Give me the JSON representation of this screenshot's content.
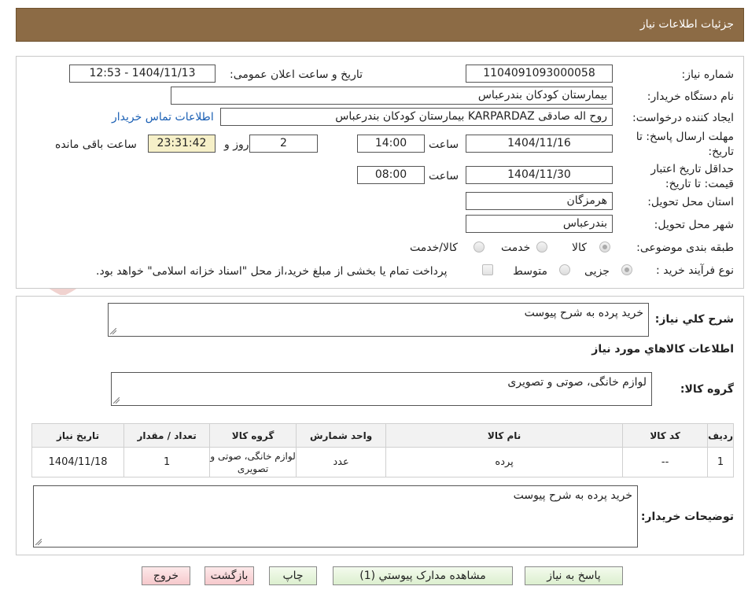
{
  "header": {
    "title": "جزئیات اطلاعات نیاز"
  },
  "info": {
    "need_number_label": "شماره نیاز:",
    "need_number": "1104091093000058",
    "announce_label": "تاریخ و ساعت اعلان عمومی:",
    "announce_value": "1404/11/13 - 12:53",
    "buyer_org_label": "نام دستگاه خریدار:",
    "buyer_org": "بیمارستان کودکان بندرعباس",
    "requester_label": "ایجاد کننده درخواست:",
    "requester": "روح اله صادقی KARPARDAZ بیمارستان کودکان بندرعباس",
    "contact_link": "اطلاعات تماس خریدار",
    "deadline_label": "مهلت ارسال پاسخ: تا تاریخ:",
    "deadline_date": "1404/11/16",
    "time_label": "ساعت",
    "deadline_time": "14:00",
    "days_value": "2",
    "days_label": "روز و",
    "remaining_time": "23:31:42",
    "remaining_label": "ساعت باقی مانده",
    "validity_label": "حداقل تاریخ اعتبار قیمت: تا تاریخ:",
    "validity_date": "1404/11/30",
    "validity_time": "08:00",
    "province_label": "استان محل تحویل:",
    "province": "هرمزگان",
    "city_label": "شهر محل تحویل:",
    "city": "بندرعباس",
    "category_label": "طبقه بندی موضوعی:",
    "category_options": [
      "کالا",
      "خدمت",
      "کالا/خدمت"
    ],
    "process_label": "نوع فرآیند خرید :",
    "process_options": [
      "جزیی",
      "متوسط"
    ],
    "payment_note": "پرداخت تمام یا بخشی از مبلغ خرید،از محل \"اسناد خزانه اسلامی\" خواهد بود."
  },
  "details": {
    "summary_label": "شرح کلي نياز:",
    "summary_text": "خرید پرده به شرح پیوست",
    "goods_info_title": "اطلاعات کالاهاي مورد نياز",
    "goods_group_label": "گروه کالا:",
    "goods_group_text": "لوازم خانگی، صوتی و تصویری",
    "table_headers": [
      "رديف",
      "کد کالا",
      "نام کالا",
      "واحد شمارش",
      "گروه کالا",
      "تعداد / مقدار",
      "تاريخ نياز"
    ],
    "table_rows": [
      [
        "1",
        "--",
        "پرده",
        "عدد",
        "لوازم خانگی، صوتی و تصویری",
        "1",
        "1404/11/18"
      ]
    ],
    "buyer_notes_label": "توضيحات خريدار:",
    "buyer_notes_text": "خرید پرده به شرح پیوست"
  },
  "buttons": {
    "reply": "پاسخ به نیاز",
    "attachments": "مشاهده مدارک پیوستي (1)",
    "print": "چاپ",
    "back": "بازگشت",
    "exit": "خروج"
  },
  "watermark_text": "AriaTender.neT",
  "colors": {
    "header_bg": "#8c6b45",
    "link": "#1a5fb4",
    "green_btn": "#dcefcf",
    "pink_btn": "#f6c9cc",
    "watermark": "#c0392b"
  }
}
